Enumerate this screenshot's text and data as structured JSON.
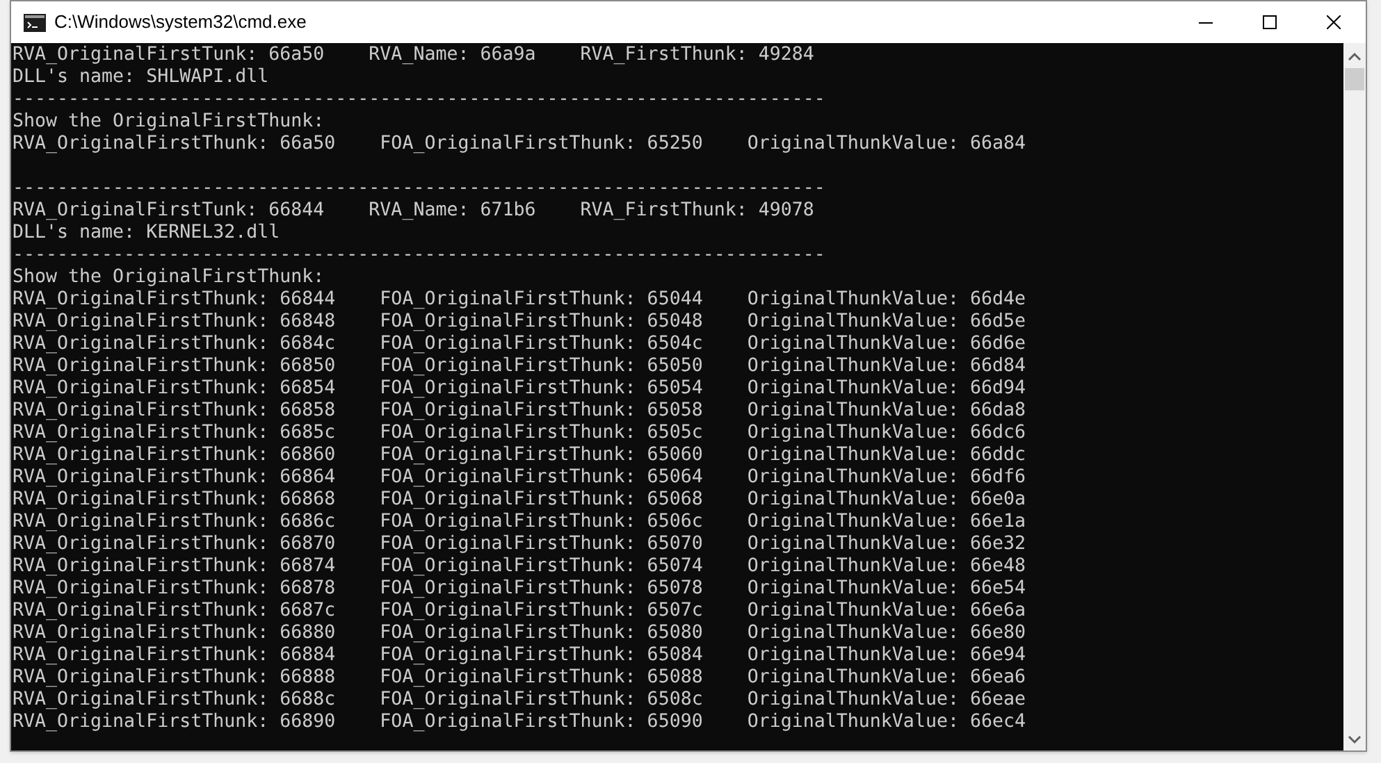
{
  "window": {
    "title": "C:\\Windows\\system32\\cmd.exe"
  },
  "console": {
    "lines": [
      {
        "kind": "text",
        "text": "RVA_OriginalFirstTunk: 66a50    RVA_Name: 66a9a    RVA_FirstThunk: 49284"
      },
      {
        "kind": "text",
        "text": "DLL's name: SHLWAPI.dll"
      },
      {
        "kind": "text",
        "text": "-------------------------------------------------------------------------"
      },
      {
        "kind": "text",
        "text": "Show the OriginalFirstThunk:"
      },
      {
        "kind": "text",
        "text": "RVA_OriginalFirstThunk: 66a50    FOA_OriginalFirstThunk: 65250    OriginalThunkValue: 66a84"
      },
      {
        "kind": "blank"
      },
      {
        "kind": "text",
        "text": "-------------------------------------------------------------------------"
      },
      {
        "kind": "text",
        "text": "RVA_OriginalFirstTunk: 66844    RVA_Name: 671b6    RVA_FirstThunk: 49078"
      },
      {
        "kind": "text",
        "text": "DLL's name: KERNEL32.dll"
      },
      {
        "kind": "text",
        "text": "-------------------------------------------------------------------------"
      },
      {
        "kind": "text",
        "text": "Show the OriginalFirstThunk:"
      },
      {
        "kind": "text",
        "text": "RVA_OriginalFirstThunk: 66844    FOA_OriginalFirstThunk: 65044    OriginalThunkValue: 66d4e"
      },
      {
        "kind": "text",
        "text": "RVA_OriginalFirstThunk: 66848    FOA_OriginalFirstThunk: 65048    OriginalThunkValue: 66d5e"
      },
      {
        "kind": "text",
        "text": "RVA_OriginalFirstThunk: 6684c    FOA_OriginalFirstThunk: 6504c    OriginalThunkValue: 66d6e"
      },
      {
        "kind": "text",
        "text": "RVA_OriginalFirstThunk: 66850    FOA_OriginalFirstThunk: 65050    OriginalThunkValue: 66d84"
      },
      {
        "kind": "text",
        "text": "RVA_OriginalFirstThunk: 66854    FOA_OriginalFirstThunk: 65054    OriginalThunkValue: 66d94"
      },
      {
        "kind": "text",
        "text": "RVA_OriginalFirstThunk: 66858    FOA_OriginalFirstThunk: 65058    OriginalThunkValue: 66da8"
      },
      {
        "kind": "text",
        "text": "RVA_OriginalFirstThunk: 6685c    FOA_OriginalFirstThunk: 6505c    OriginalThunkValue: 66dc6"
      },
      {
        "kind": "text",
        "text": "RVA_OriginalFirstThunk: 66860    FOA_OriginalFirstThunk: 65060    OriginalThunkValue: 66ddc"
      },
      {
        "kind": "text",
        "text": "RVA_OriginalFirstThunk: 66864    FOA_OriginalFirstThunk: 65064    OriginalThunkValue: 66df6"
      },
      {
        "kind": "text",
        "text": "RVA_OriginalFirstThunk: 66868    FOA_OriginalFirstThunk: 65068    OriginalThunkValue: 66e0a"
      },
      {
        "kind": "text",
        "text": "RVA_OriginalFirstThunk: 6686c    FOA_OriginalFirstThunk: 6506c    OriginalThunkValue: 66e1a"
      },
      {
        "kind": "text",
        "text": "RVA_OriginalFirstThunk: 66870    FOA_OriginalFirstThunk: 65070    OriginalThunkValue: 66e32"
      },
      {
        "kind": "text",
        "text": "RVA_OriginalFirstThunk: 66874    FOA_OriginalFirstThunk: 65074    OriginalThunkValue: 66e48"
      },
      {
        "kind": "text",
        "text": "RVA_OriginalFirstThunk: 66878    FOA_OriginalFirstThunk: 65078    OriginalThunkValue: 66e54"
      },
      {
        "kind": "text",
        "text": "RVA_OriginalFirstThunk: 6687c    FOA_OriginalFirstThunk: 6507c    OriginalThunkValue: 66e6a"
      },
      {
        "kind": "text",
        "text": "RVA_OriginalFirstThunk: 66880    FOA_OriginalFirstThunk: 65080    OriginalThunkValue: 66e80"
      },
      {
        "kind": "text",
        "text": "RVA_OriginalFirstThunk: 66884    FOA_OriginalFirstThunk: 65084    OriginalThunkValue: 66e94"
      },
      {
        "kind": "text",
        "text": "RVA_OriginalFirstThunk: 66888    FOA_OriginalFirstThunk: 65088    OriginalThunkValue: 66ea6"
      },
      {
        "kind": "text",
        "text": "RVA_OriginalFirstThunk: 6688c    FOA_OriginalFirstThunk: 6508c    OriginalThunkValue: 66eae"
      },
      {
        "kind": "text",
        "text": "RVA_OriginalFirstThunk: 66890    FOA_OriginalFirstThunk: 65090    OriginalThunkValue: 66ec4"
      }
    ]
  }
}
